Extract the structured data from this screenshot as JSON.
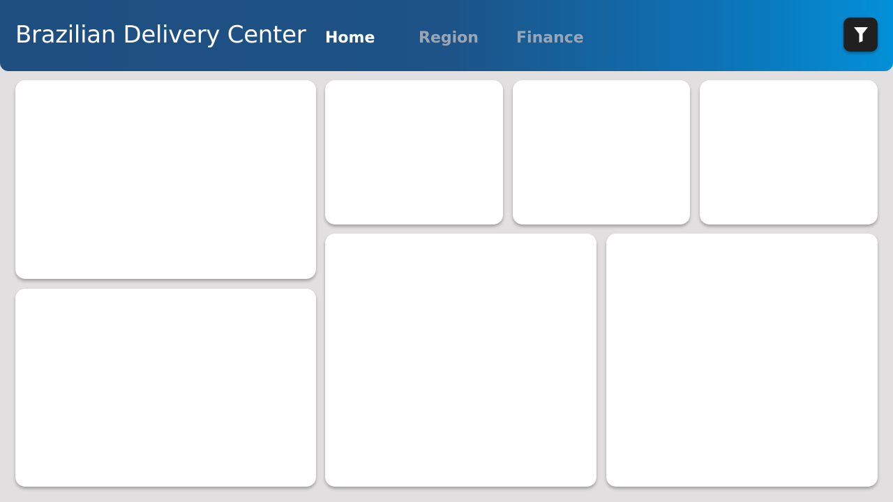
{
  "header": {
    "title": "Brazilian Delivery Center",
    "tabs": [
      {
        "label": "Home",
        "active": true
      },
      {
        "label": "Region",
        "active": false
      },
      {
        "label": "Finance",
        "active": false
      }
    ],
    "filter_icon": "filter-icon"
  },
  "colors": {
    "header_start": "#1f4e80",
    "header_end": "#0390d8",
    "background": "#e1dfdf",
    "card": "#ffffff",
    "filter_button": "#202020",
    "tab_active": "#ffffff",
    "tab_inactive": "#9aa6b4"
  },
  "cards": [
    {
      "name": "card-top-left"
    },
    {
      "name": "card-bottom-left"
    },
    {
      "name": "card-kpi-1"
    },
    {
      "name": "card-kpi-2"
    },
    {
      "name": "card-kpi-3"
    },
    {
      "name": "card-bottom-middle"
    },
    {
      "name": "card-bottom-right"
    }
  ]
}
